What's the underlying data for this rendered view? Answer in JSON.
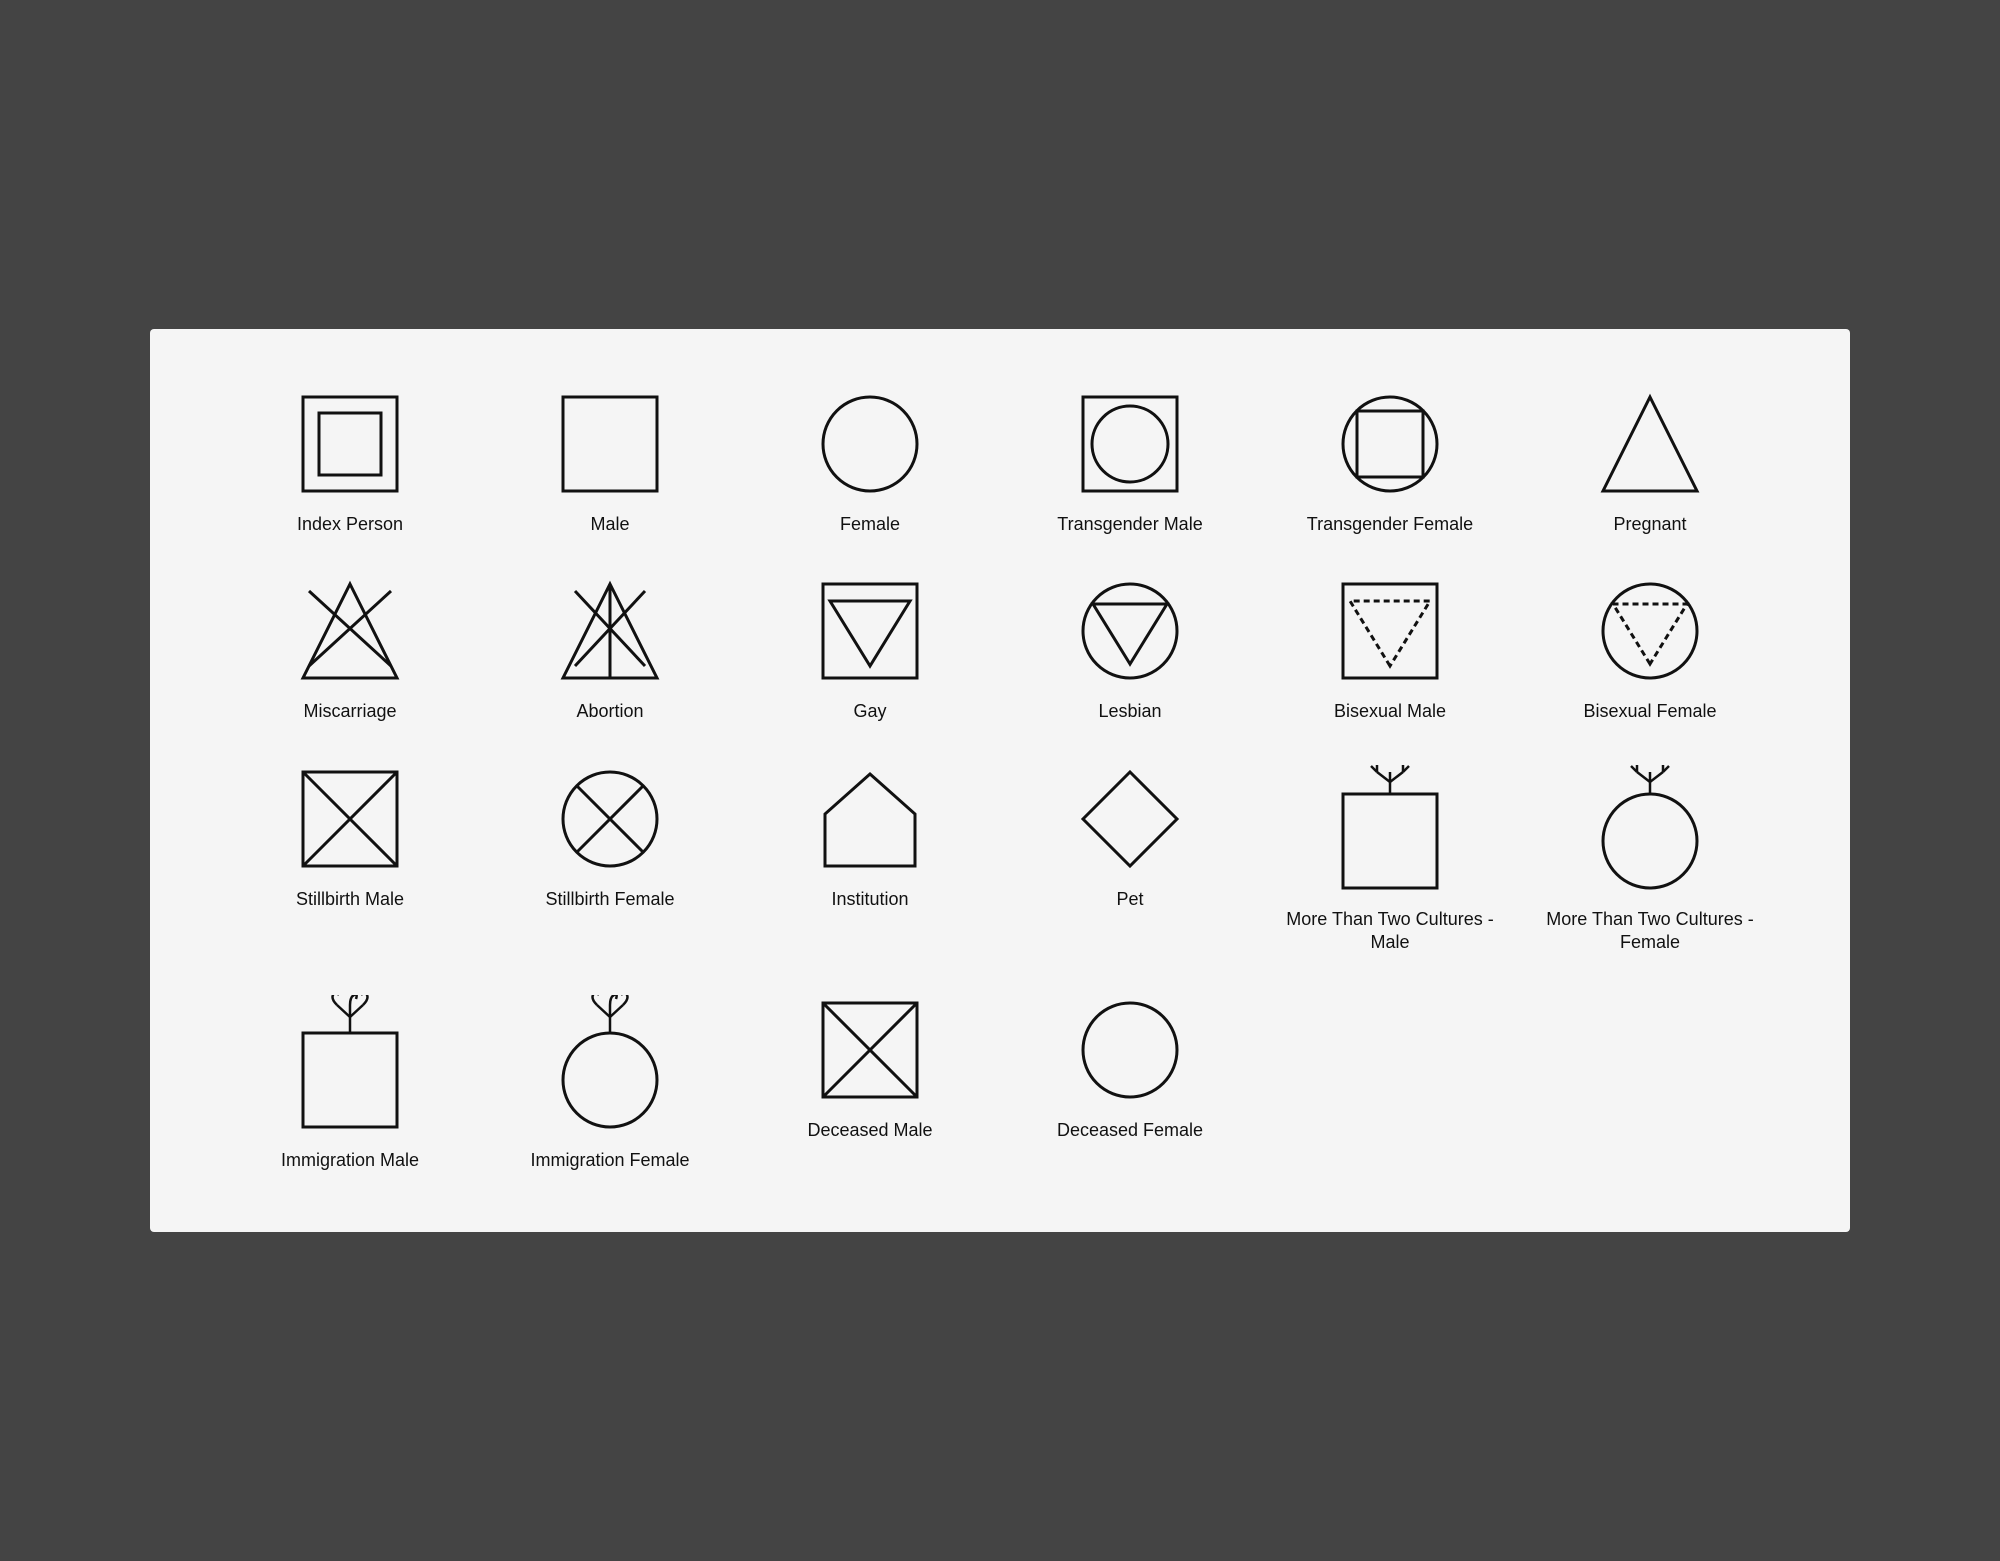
{
  "symbols": [
    {
      "id": "index-person",
      "label": "Index Person"
    },
    {
      "id": "male",
      "label": "Male"
    },
    {
      "id": "female",
      "label": "Female"
    },
    {
      "id": "transgender-male",
      "label": "Transgender Male"
    },
    {
      "id": "transgender-female",
      "label": "Transgender Female"
    },
    {
      "id": "pregnant",
      "label": "Pregnant"
    },
    {
      "id": "miscarriage",
      "label": "Miscarriage"
    },
    {
      "id": "abortion",
      "label": "Abortion"
    },
    {
      "id": "gay",
      "label": "Gay"
    },
    {
      "id": "lesbian",
      "label": "Lesbian"
    },
    {
      "id": "bisexual-male",
      "label": "Bisexual Male"
    },
    {
      "id": "bisexual-female",
      "label": "Bisexual Female"
    },
    {
      "id": "stillbirth-male",
      "label": "Stillbirth Male"
    },
    {
      "id": "stillbirth-female",
      "label": "Stillbirth Female"
    },
    {
      "id": "institution",
      "label": "Institution"
    },
    {
      "id": "pet",
      "label": "Pet"
    },
    {
      "id": "more-two-male",
      "label": "More Than Two Cultures - Male"
    },
    {
      "id": "more-two-female",
      "label": "More Than Two Cultures - Female"
    },
    {
      "id": "immigration-male",
      "label": "Immigration Male"
    },
    {
      "id": "immigration-female",
      "label": "Immigration Female"
    },
    {
      "id": "deceased-male",
      "label": "Deceased Male"
    },
    {
      "id": "deceased-female",
      "label": "Deceased Female"
    }
  ]
}
